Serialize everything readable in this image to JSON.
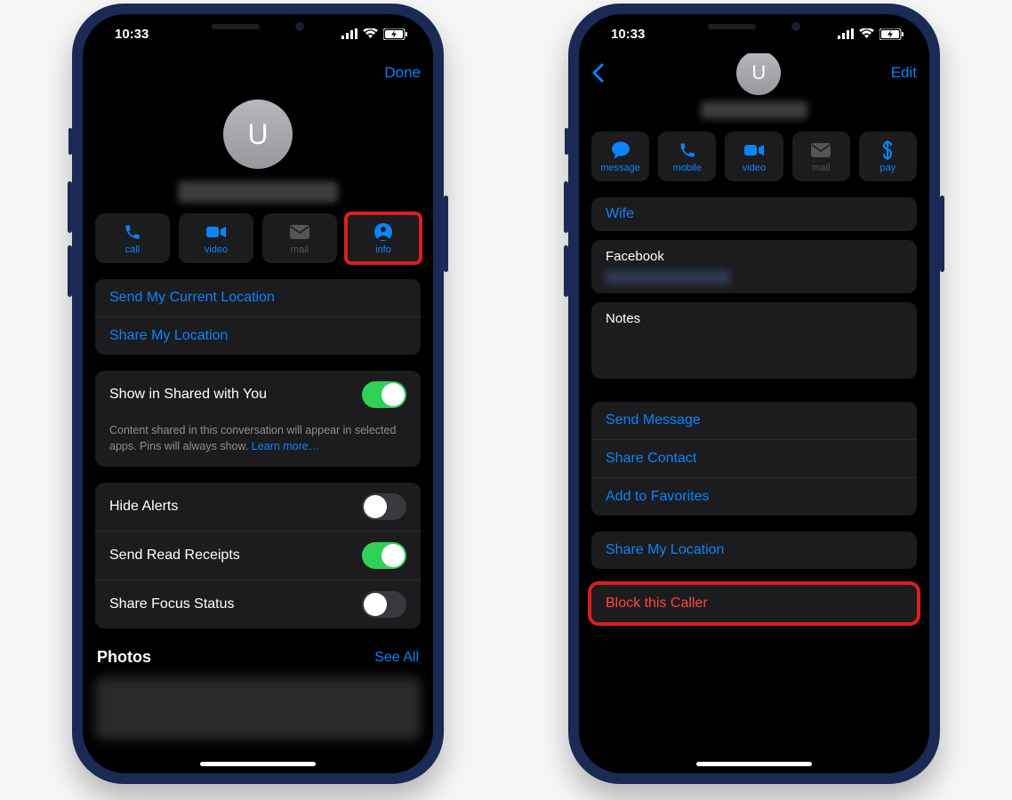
{
  "status": {
    "time": "10:33"
  },
  "left": {
    "nav": {
      "done": "Done"
    },
    "avatar": {
      "initial": "U"
    },
    "actions": {
      "call": "call",
      "video": "video",
      "mail": "mail",
      "info": "info"
    },
    "links": {
      "send_location": "Send My Current Location",
      "share_location": "Share My Location"
    },
    "shared": {
      "title": "Show in Shared with You",
      "desc": "Content shared in this conversation will appear in selected apps. Pins will always show. ",
      "learn_more": "Learn more…"
    },
    "settings": {
      "hide_alerts": "Hide Alerts",
      "read_receipts": "Send Read Receipts",
      "focus": "Share Focus Status"
    },
    "photos": {
      "title": "Photos",
      "see_all": "See All"
    }
  },
  "right": {
    "nav": {
      "edit": "Edit"
    },
    "avatar": {
      "initial": "U"
    },
    "actions": {
      "message": "message",
      "mobile": "mobile",
      "video": "video",
      "mail": "mail",
      "pay": "pay"
    },
    "relation": "Wife",
    "facebook_label": "Facebook",
    "notes_label": "Notes",
    "links": {
      "send_message": "Send Message",
      "share_contact": "Share Contact",
      "add_fav": "Add to Favorites",
      "share_location": "Share My Location",
      "block": "Block this Caller"
    }
  }
}
